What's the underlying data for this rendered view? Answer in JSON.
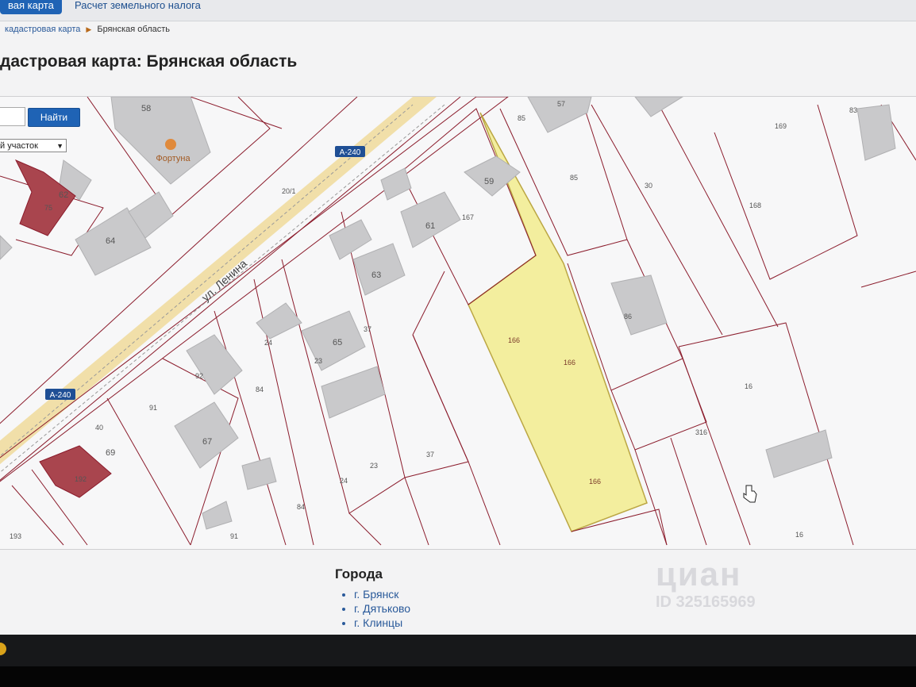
{
  "nav": {
    "active_tab": "вая карта",
    "tab2": "Расчет земельного налога"
  },
  "breadcrumb": {
    "parent": "кадастровая карта",
    "current": "Брянская область"
  },
  "page_title": "дастровая карта: Брянская область",
  "search": {
    "placeholder": "",
    "button_label": "Найти",
    "select_value": "й участок"
  },
  "map": {
    "street_label": "ул. Ленина",
    "road_badges": [
      "А-240",
      "А-240"
    ],
    "poi_name": "Фортуна",
    "parcel_numbers": [
      "58",
      "85",
      "57",
      "83",
      "169",
      "20/1",
      "85",
      "30",
      "168",
      "62",
      "75",
      "64",
      "59",
      "61",
      "167",
      "63",
      "65",
      "37",
      "24",
      "23",
      "86",
      "92",
      "84",
      "91",
      "40",
      "69",
      "67",
      "166",
      "166",
      "166",
      "16",
      "316",
      "192",
      "193",
      "91",
      "84",
      "24",
      "23",
      "37",
      "166",
      "16"
    ],
    "highlight_color": "#f3ee9a",
    "boundary_color": "#8b1c2c",
    "road_color": "#f2dea6"
  },
  "cities": {
    "heading": "Города",
    "items": [
      "г. Брянск",
      "г. Дятьково",
      "г. Клинцы"
    ]
  },
  "watermark": {
    "logo": "циан",
    "id": "ID 325165969"
  }
}
